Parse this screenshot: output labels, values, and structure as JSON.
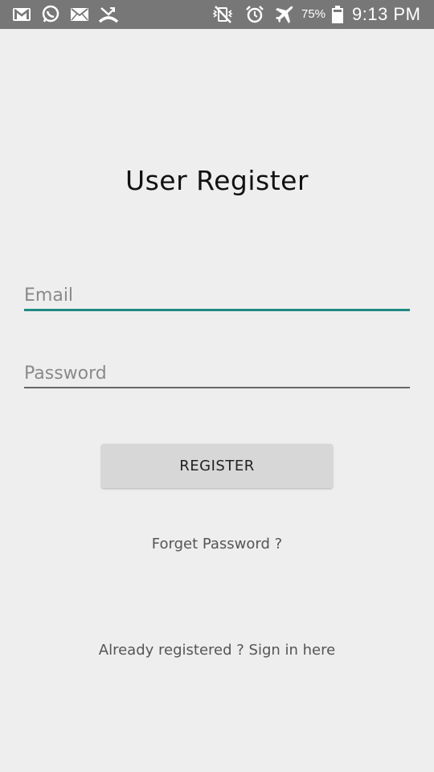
{
  "status_bar": {
    "left_icons": [
      "gmail-icon",
      "whatsapp-icon",
      "email-icon",
      "missed-call-icon"
    ],
    "right_icons": [
      "mute-vibrate-icon",
      "alarm-icon",
      "airplane-mode-icon"
    ],
    "battery_percent": "75%",
    "battery_level": 0.75,
    "time": "9:13 PM"
  },
  "page": {
    "title": "User Register"
  },
  "form": {
    "email_placeholder": "Email",
    "email_value": "",
    "password_placeholder": "Password",
    "password_value": "",
    "register_label": "REGISTER"
  },
  "links": {
    "forget_password": "Forget Password ?",
    "sign_in": "Already registered ? Sign in here"
  },
  "colors": {
    "background": "#eeeeee",
    "status_bar": "#777777",
    "accent": "#1f8a80",
    "button": "#d7d7d7"
  }
}
